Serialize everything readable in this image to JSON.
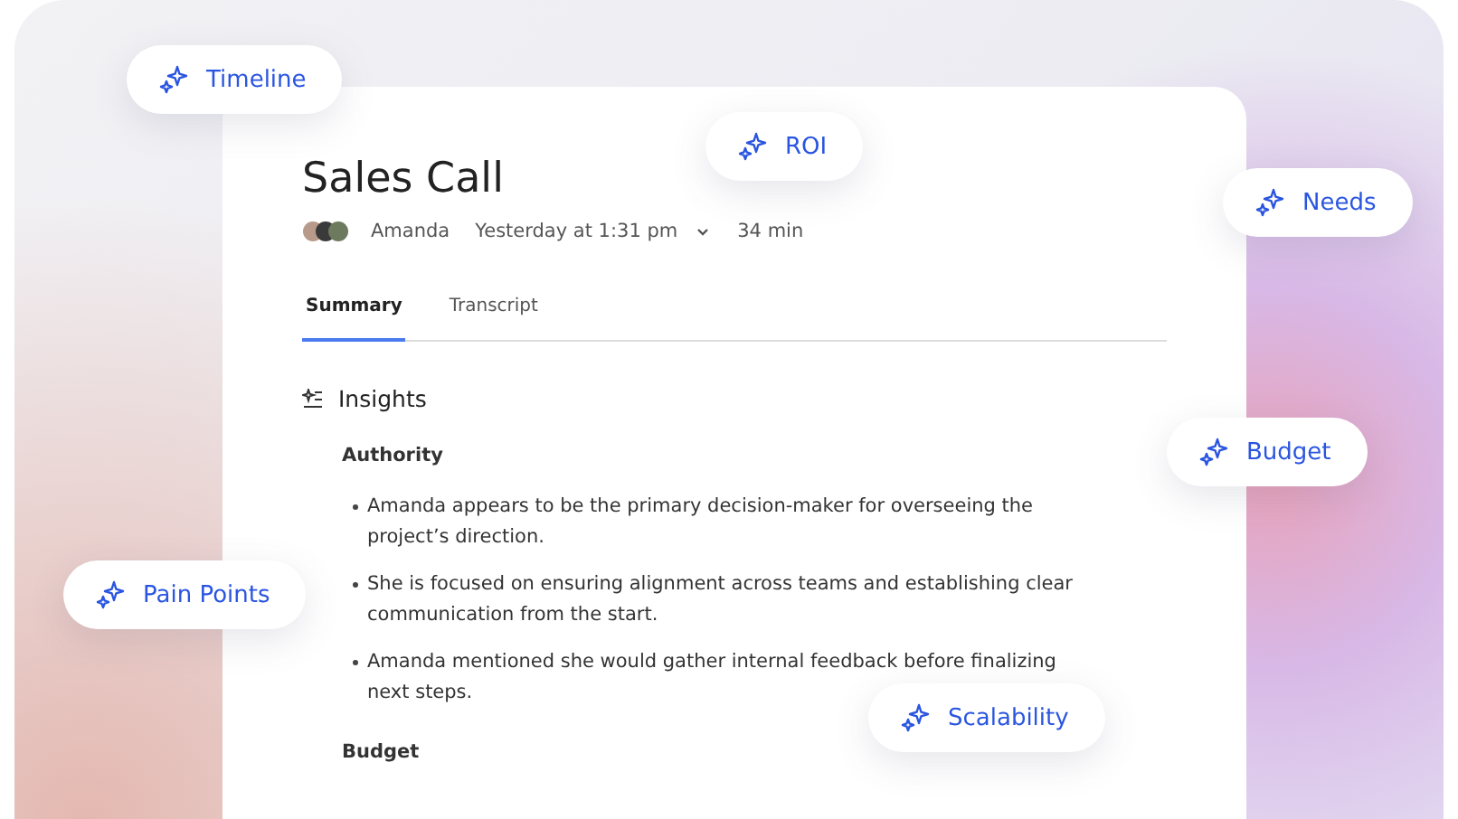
{
  "card": {
    "title": "Sales Call",
    "participant": "Amanda",
    "date": "Yesterday at 1:31 pm",
    "duration": "34 min",
    "tabs": [
      {
        "label": "Summary",
        "selected": true
      },
      {
        "label": "Transcript",
        "selected": false
      }
    ],
    "section_title": "Insights",
    "groups": [
      {
        "heading": "Authority",
        "bullets": [
          "Amanda appears to be the primary decision-maker for overseeing the project’s direction.",
          "She is focused on ensuring alignment across teams and establishing clear communication from the start.",
          "Amanda mentioned she would gather internal feedback before finalizing next steps."
        ]
      },
      {
        "heading": "Budget"
      }
    ]
  },
  "chips": [
    {
      "label": "Timeline"
    },
    {
      "label": "ROI"
    },
    {
      "label": "Needs"
    },
    {
      "label": "Budget"
    },
    {
      "label": "Pain Points"
    },
    {
      "label": "Scalability"
    }
  ]
}
